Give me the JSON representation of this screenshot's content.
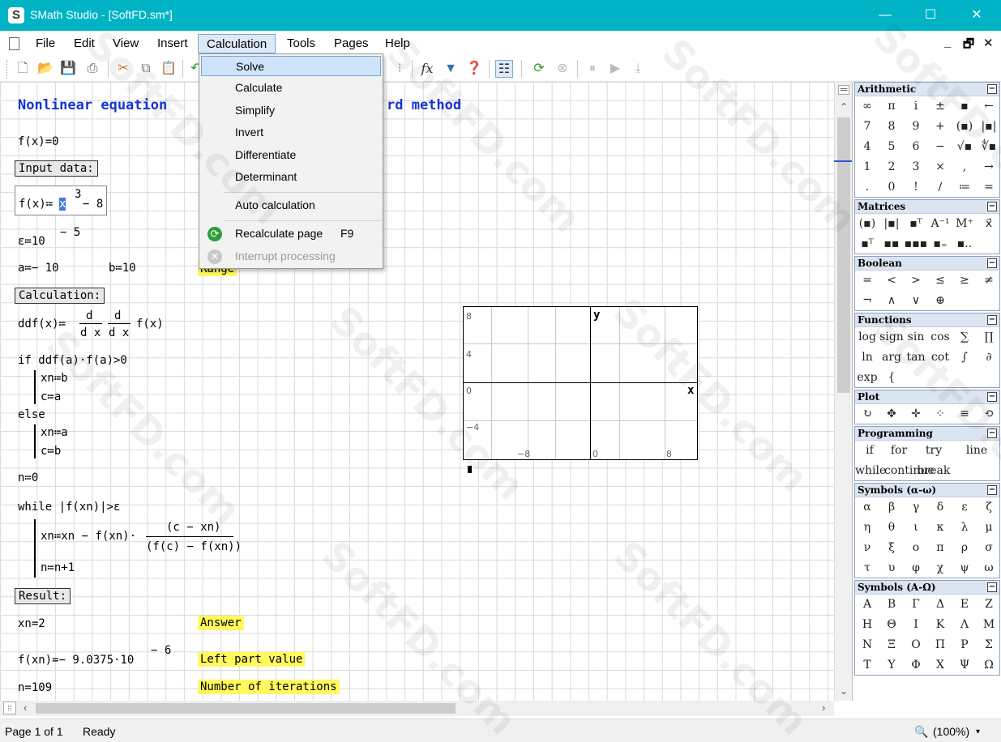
{
  "window": {
    "title": "SMath Studio - [SoftFD.sm*]",
    "app_icon": "S",
    "minimize": "—",
    "maximize": "☐",
    "close": "✕"
  },
  "menu": {
    "items": [
      "File",
      "Edit",
      "View",
      "Insert",
      "Calculation",
      "Tools",
      "Pages",
      "Help"
    ],
    "active": "Calculation",
    "mdi": {
      "minimize": "_",
      "restore": "🗗",
      "close": "✕"
    }
  },
  "calculation_menu": {
    "solve": "Solve",
    "calculate": "Calculate",
    "simplify": "Simplify",
    "invert": "Invert",
    "differentiate": "Differentiate",
    "determinant": "Determinant",
    "auto_calculation": "Auto calculation",
    "recalculate_page": "Recalculate page",
    "recalculate_shortcut": "F9",
    "interrupt_processing": "Interrupt processing"
  },
  "toolbar": {
    "fx": "fx"
  },
  "worksheet": {
    "title": "Nonlinear equation",
    "title_tail": "rd method",
    "eq_fx0": "f(x)=0",
    "input_header": "Input data:",
    "fx_def_lhs": "f(x)≔",
    "fx_def_var": "x",
    "fx_def_exp": "3",
    "fx_def_tail": "− 8",
    "eps_def": "ε≔10",
    "eps_exp": "− 5",
    "ab_def_a": "a≔− 10",
    "ab_def_b": "b≔10",
    "range_label": "Range",
    "calc_header": "Calculation:",
    "ddf_lhs": "ddf(x)≔",
    "ddf_d": "d",
    "ddf_dx": "d x",
    "ddf_fx": "f(x)",
    "if_line": "if  ddf(a)·f(a)>0",
    "if_xn": "xn≔b",
    "if_c": "c≔a",
    "else": "else",
    "else_xn": "xn≔a",
    "else_c": "c≔b",
    "n_init": "n≔0",
    "while_line": "while  |f(xn)|>ε",
    "while_xn": "xn≔xn − f(xn)·",
    "while_num": "(c − xn)",
    "while_den": "(f(c) − f(xn))",
    "while_n": "n≔n+1",
    "result_header": "Result:",
    "xn_result": "xn=2",
    "answer_label": "Answer",
    "fxn_result": "f(xn)=− 9.0375·10",
    "fxn_exp": "− 6",
    "left_part_label": "Left part value",
    "n_result": "n=109",
    "iterations_label": "Number of iterations"
  },
  "plot": {
    "y_label": "y",
    "x_label": "x",
    "y_ticks": [
      "8",
      "4",
      "0",
      "−4"
    ],
    "x_ticks": [
      "−8",
      "0",
      "8"
    ]
  },
  "panels": {
    "arithmetic": {
      "title": "Arithmetic",
      "cells": [
        "∞",
        "π",
        "i",
        "±",
        "▪",
        "←",
        "7",
        "8",
        "9",
        "+",
        "(▪)",
        "|▪|",
        "4",
        "5",
        "6",
        "−",
        "√▪",
        "∜▪",
        "1",
        "2",
        "3",
        "×",
        ",",
        "→",
        ".",
        "0",
        "!",
        "/",
        "≔",
        "="
      ]
    },
    "matrices": {
      "title": "Matrices",
      "cells": [
        "(▪)",
        "|▪|",
        "▪ᵀ",
        "A⁻¹",
        "M⁺",
        "x⃗",
        "▪ᵀ",
        "▪▪",
        "▪▪▪",
        "▪₌",
        "▪.."
      ]
    },
    "boolean": {
      "title": "Boolean",
      "cells": [
        "=",
        "<",
        ">",
        "≤",
        "≥",
        "≠",
        "¬",
        "∧",
        "∨",
        "⊕"
      ]
    },
    "functions": {
      "title": "Functions",
      "cells": [
        "log",
        "sign",
        "sin",
        "cos",
        "∑",
        "∏",
        "ln",
        "arg",
        "tan",
        "cot",
        "∫",
        "∂",
        "exp",
        "{"
      ]
    },
    "plot": {
      "title": "Plot",
      "cells": [
        "↻",
        "✥",
        "✛",
        "⁘",
        "≡",
        "⟲"
      ]
    },
    "programming": {
      "title": "Programming",
      "cells": [
        "if",
        "for",
        "try",
        "line",
        "while",
        "continue",
        "break"
      ]
    },
    "symbols_lower": {
      "title": "Symbols (α-ω)",
      "cells": [
        "α",
        "β",
        "γ",
        "δ",
        "ε",
        "ζ",
        "η",
        "θ",
        "ι",
        "κ",
        "λ",
        "μ",
        "ν",
        "ξ",
        "ο",
        "π",
        "ρ",
        "σ",
        "τ",
        "υ",
        "φ",
        "χ",
        "ψ",
        "ω"
      ]
    },
    "symbols_upper": {
      "title": "Symbols (Α-Ω)",
      "cells": [
        "Α",
        "Β",
        "Γ",
        "Δ",
        "Ε",
        "Ζ",
        "Η",
        "Θ",
        "Ι",
        "Κ",
        "Λ",
        "Μ",
        "Ν",
        "Ξ",
        "Ο",
        "Π",
        "Ρ",
        "Σ",
        "Τ",
        "Υ",
        "Φ",
        "Χ",
        "Ψ",
        "Ω"
      ]
    }
  },
  "status": {
    "page": "Page 1 of 1",
    "state": "Ready",
    "zoom": "(100%)",
    "zoom_icon": "🔍"
  },
  "watermark": "SoftFD.com",
  "colors": {
    "titlebar": "#00b4c5",
    "accent": "#1633d6",
    "highlight": "#fff95e"
  }
}
